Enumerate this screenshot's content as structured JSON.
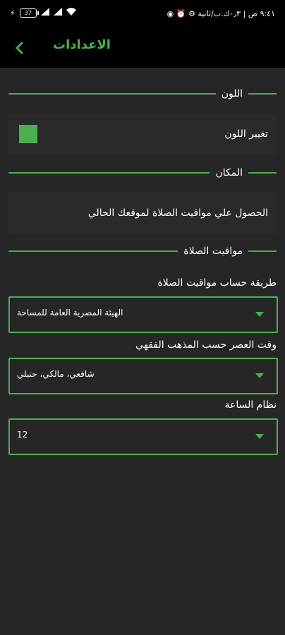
{
  "status_bar": {
    "time_text": "٩:٤١ ص | ٠٫٣ك.ب/ثانية",
    "battery_level": "37",
    "left_icons": [
      "charging-icon",
      "signal-icon",
      "signal-icon",
      "wifi-icon"
    ],
    "right_icons": [
      "alarm-icon",
      "settings-icon",
      "whatsapp-icon"
    ]
  },
  "toolbar": {
    "title": "الاعدادات",
    "accent": "#4caf50"
  },
  "sections": {
    "color": {
      "title": "اللون",
      "row_label": "تغيير اللون",
      "swatch_color": "#4caf50"
    },
    "location": {
      "title": "المكان",
      "row_label": "الحصول علي مواقيت الصلاة لموقعك الحالي"
    },
    "prayer_times": {
      "title": "مواقيت الصلاة",
      "calc_method": {
        "label": "طريقة حساب مواقيت الصلاة",
        "selected": "الهيئة المصرية العامة للمساحة"
      },
      "asr_method": {
        "label": "وقت العصر حسب المذهب الفقهي",
        "selected": "شافعي، مالكي، حنبلي"
      },
      "clock_format": {
        "label": "نظام الساعة",
        "selected": "12"
      }
    }
  }
}
